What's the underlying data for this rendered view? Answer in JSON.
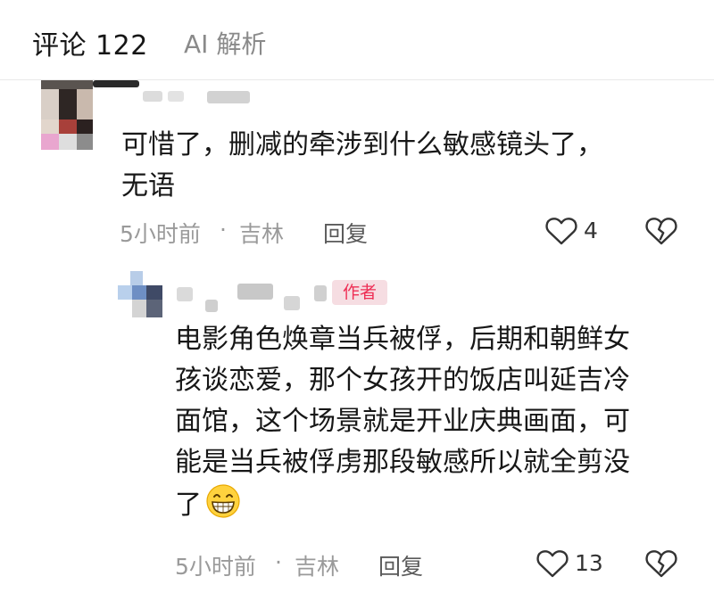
{
  "tabs": {
    "comments_label": "评论 122",
    "ai_label": "AI 解析"
  },
  "comments": [
    {
      "text_lines": [
        "可惜了，删减的牵涉到什么敏感镜头了，",
        "无语"
      ],
      "time": "5小时前",
      "separator": "·",
      "location": "吉林",
      "reply_label": "回复",
      "likes": "4"
    },
    {
      "badge": "作者",
      "text_lines": [
        "电影角色焕章当兵被俘，后期和朝鲜女",
        "孩谈恋爱，那个女孩开的饭店叫延吉冷",
        "面馆，这个场景就是开业庆典画面，可",
        "能是当兵被俘虏那段敏感所以就全剪没",
        "了"
      ],
      "emoji": "grinning-face",
      "time": "5小时前",
      "separator": "·",
      "location": "吉林",
      "reply_label": "回复",
      "likes": "13"
    }
  ],
  "colors": {
    "badge_bg": "#f6dde2",
    "badge_text": "#ee2f55",
    "meta": "#9a9a9a"
  }
}
